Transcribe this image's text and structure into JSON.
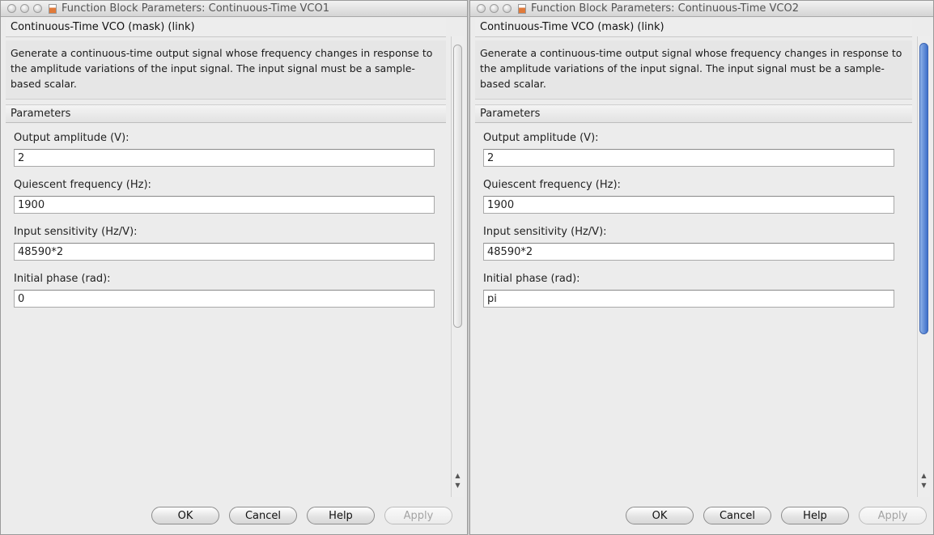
{
  "windows": [
    {
      "title": "Function Block Parameters: Continuous-Time VCO1",
      "mask_title": "Continuous-Time VCO (mask) (link)",
      "description": "Generate a continuous-time output signal whose frequency changes in response to the amplitude variations of the input signal. The input signal must be a sample-based scalar.",
      "section": "Parameters",
      "params": [
        {
          "label": "Output amplitude (V):",
          "value": "2"
        },
        {
          "label": "Quiescent frequency (Hz):",
          "value": "1900"
        },
        {
          "label": "Input sensitivity (Hz/V):",
          "value": "48590*2"
        },
        {
          "label": "Initial phase (rad):",
          "value": "0"
        }
      ],
      "buttons": {
        "ok": "OK",
        "cancel": "Cancel",
        "help": "Help",
        "apply": "Apply"
      }
    },
    {
      "title": "Function Block Parameters: Continuous-Time VCO2",
      "mask_title": "Continuous-Time VCO (mask) (link)",
      "description": "Generate a continuous-time output signal whose frequency changes in response to the amplitude variations of the input signal. The input signal must be a sample-based scalar.",
      "section": "Parameters",
      "params": [
        {
          "label": "Output amplitude (V):",
          "value": "2"
        },
        {
          "label": "Quiescent frequency (Hz):",
          "value": "1900"
        },
        {
          "label": "Input sensitivity (Hz/V):",
          "value": "48590*2"
        },
        {
          "label": "Initial phase (rad):",
          "value": "pi"
        }
      ],
      "buttons": {
        "ok": "OK",
        "cancel": "Cancel",
        "help": "Help",
        "apply": "Apply"
      }
    }
  ]
}
